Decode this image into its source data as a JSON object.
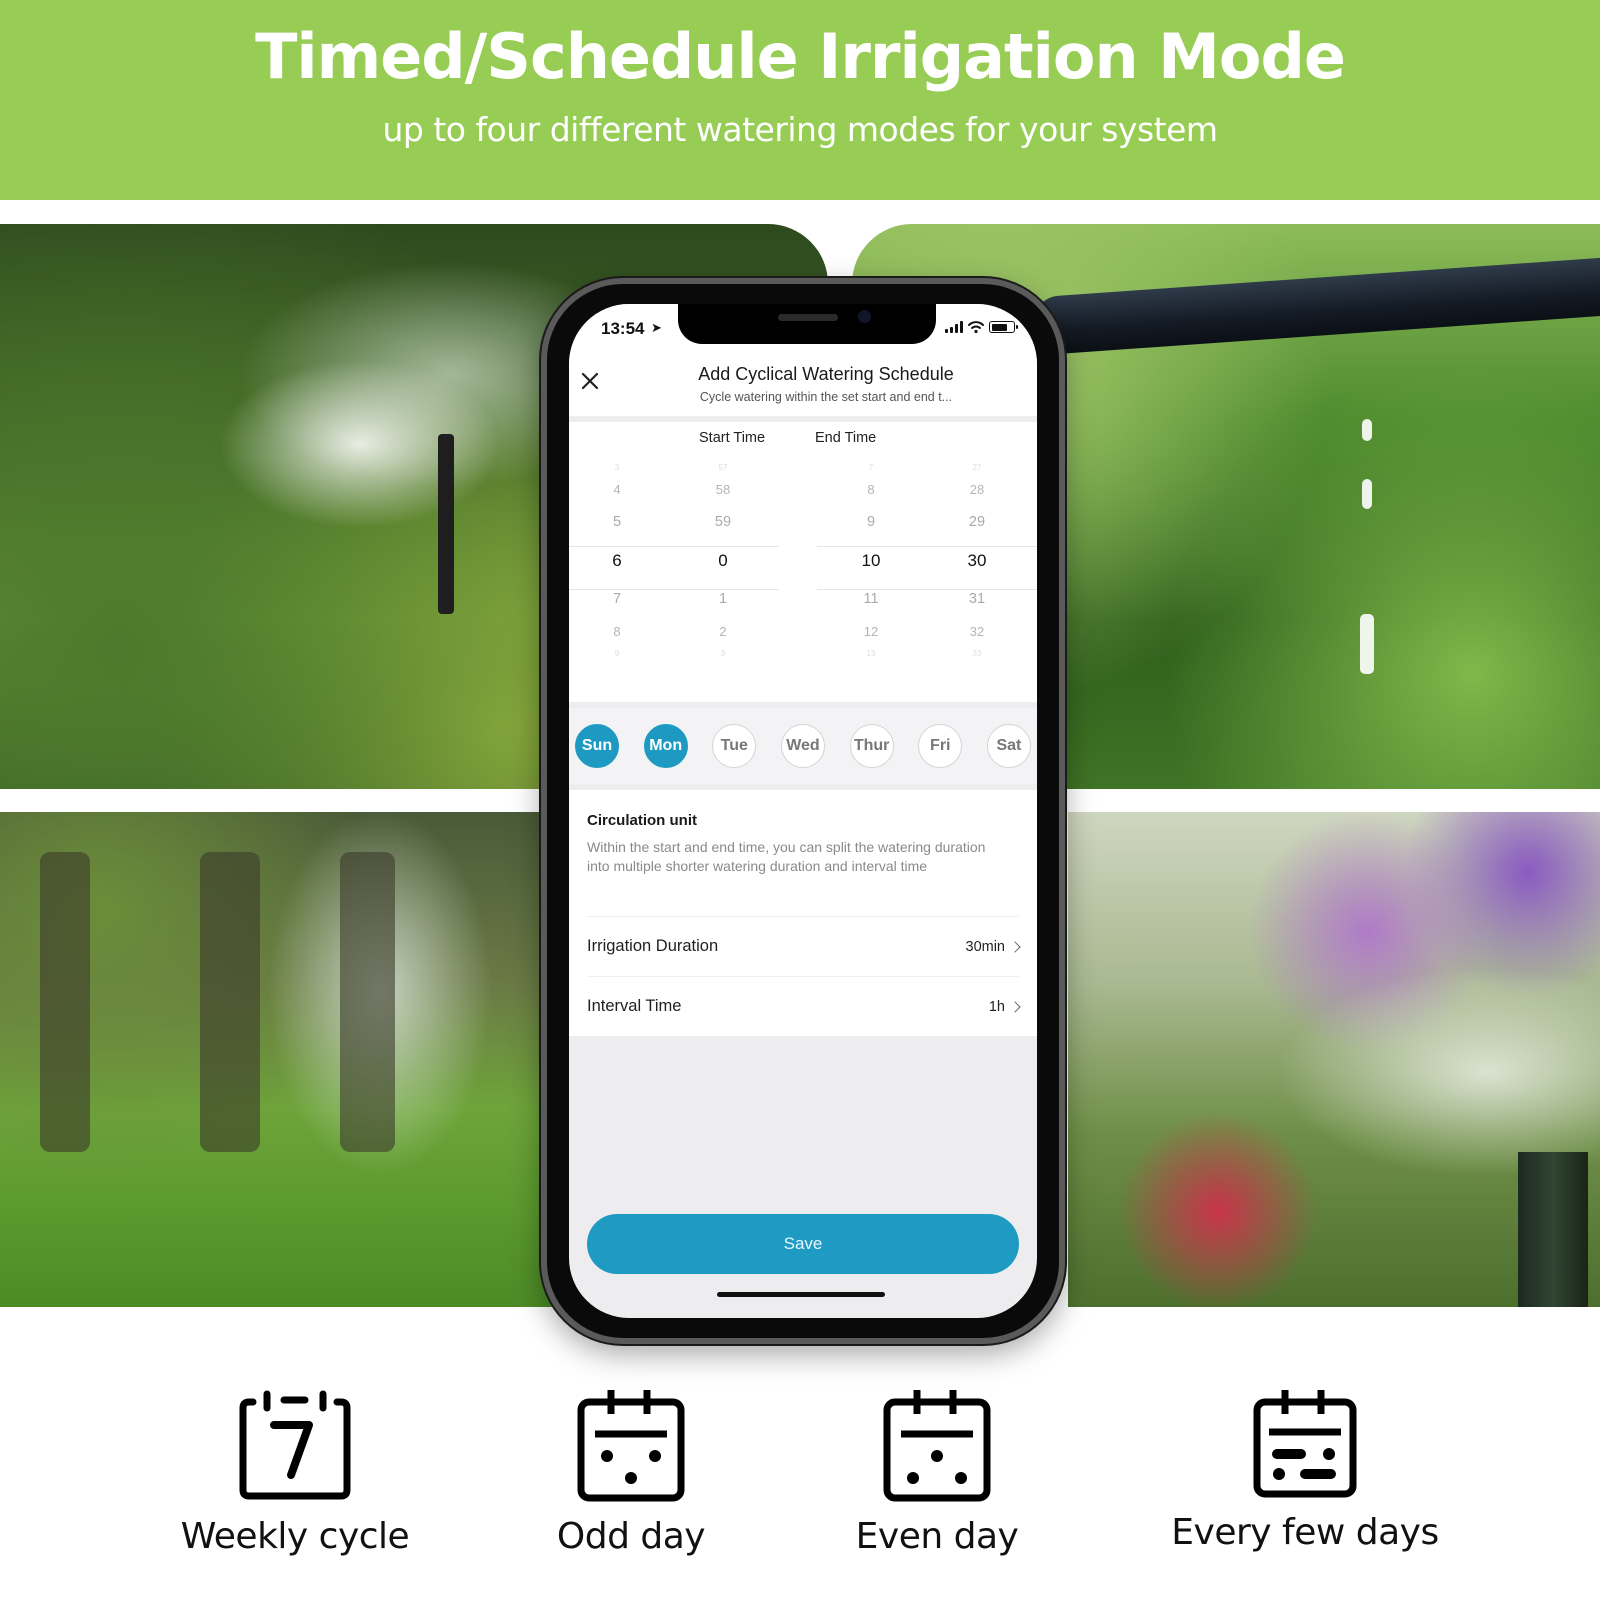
{
  "banner": {
    "title": "Timed/Schedule Irrigation Mode",
    "subtitle": "up to four different watering modes for your system",
    "color": "#97cc55"
  },
  "phone": {
    "status_bar": {
      "time": "13:54",
      "location_icon": "location-arrow-icon",
      "icons": [
        "signal-icon",
        "wifi-icon",
        "battery-icon"
      ]
    },
    "app_bar": {
      "close_icon": "close-icon",
      "title": "Add Cyclical Watering Schedule",
      "subtitle": "Cycle watering within the set start and end t..."
    },
    "time_picker": {
      "start_label": "Start Time",
      "end_label": "End Time",
      "start_hour": {
        "above_far": "3",
        "above2": "4",
        "above1": "5",
        "selected": "6",
        "below1": "7",
        "below2": "8",
        "below_far": "9"
      },
      "start_minute": {
        "above_far": "57",
        "above2": "58",
        "above1": "59",
        "selected": "0",
        "below1": "1",
        "below2": "2",
        "below_far": "3"
      },
      "end_hour": {
        "above_far": "7",
        "above2": "8",
        "above1": "9",
        "selected": "10",
        "below1": "11",
        "below2": "12",
        "below_far": "13"
      },
      "end_minute": {
        "above_far": "27",
        "above2": "28",
        "above1": "29",
        "selected": "30",
        "below1": "31",
        "below2": "32",
        "below_far": "33"
      }
    },
    "days": [
      {
        "label": "Sun",
        "selected": true
      },
      {
        "label": "Mon",
        "selected": true
      },
      {
        "label": "Tue",
        "selected": false
      },
      {
        "label": "Wed",
        "selected": false
      },
      {
        "label": "Thur",
        "selected": false
      },
      {
        "label": "Fri",
        "selected": false
      },
      {
        "label": "Sat",
        "selected": false
      }
    ],
    "circulation": {
      "title": "Circulation unit",
      "description": "Within the start and end time, you can split the watering duration into multiple shorter watering duration and interval time"
    },
    "settings": [
      {
        "label": "Irrigation Duration",
        "value": "30min"
      },
      {
        "label": "Interval Time",
        "value": "1h"
      }
    ],
    "save_label": "Save",
    "accent_color": "#1f9bc3"
  },
  "modes": [
    {
      "icon": "calendar-seven-icon",
      "label": "Weekly cycle"
    },
    {
      "icon": "calendar-odd-icon",
      "label": "Odd day"
    },
    {
      "icon": "calendar-even-icon",
      "label": "Even day"
    },
    {
      "icon": "calendar-interval-icon",
      "label": "Every few days"
    }
  ]
}
